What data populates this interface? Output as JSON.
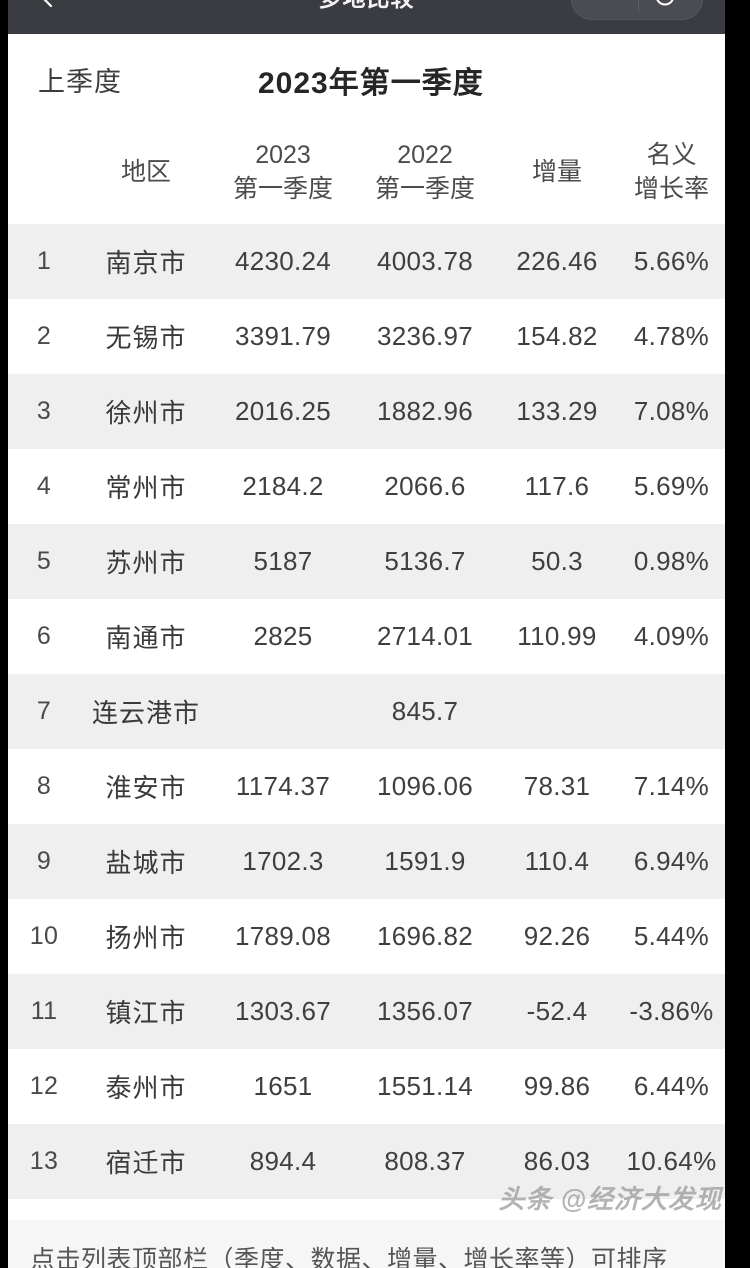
{
  "navbar": {
    "title": "多地比较",
    "back_icon": "back-chevron-icon",
    "menu_icon": "more-dots-icon",
    "target_icon": "target-circle-icon"
  },
  "quarter_bar": {
    "prev_label": "上季度",
    "current_label": "2023年第一季度"
  },
  "table": {
    "headers": [
      {
        "line1": "",
        "line2": ""
      },
      {
        "line1": "",
        "line2": "地区"
      },
      {
        "line1": "2023",
        "line2": "第一季度"
      },
      {
        "line1": "2022",
        "line2": "第一季度"
      },
      {
        "line1": "",
        "line2": "增量"
      },
      {
        "line1": "名义",
        "line2": "增长率"
      }
    ],
    "rows": [
      {
        "rank": "1",
        "name": "南京市",
        "y2023": "4230.24",
        "y2022": "4003.78",
        "increment": "226.46",
        "rate": "5.66%"
      },
      {
        "rank": "2",
        "name": "无锡市",
        "y2023": "3391.79",
        "y2022": "3236.97",
        "increment": "154.82",
        "rate": "4.78%"
      },
      {
        "rank": "3",
        "name": "徐州市",
        "y2023": "2016.25",
        "y2022": "1882.96",
        "increment": "133.29",
        "rate": "7.08%"
      },
      {
        "rank": "4",
        "name": "常州市",
        "y2023": "2184.2",
        "y2022": "2066.6",
        "increment": "117.6",
        "rate": "5.69%"
      },
      {
        "rank": "5",
        "name": "苏州市",
        "y2023": "5187",
        "y2022": "5136.7",
        "increment": "50.3",
        "rate": "0.98%"
      },
      {
        "rank": "6",
        "name": "南通市",
        "y2023": "2825",
        "y2022": "2714.01",
        "increment": "110.99",
        "rate": "4.09%"
      },
      {
        "rank": "7",
        "name": "连云港市",
        "y2023": "",
        "y2022": "845.7",
        "increment": "",
        "rate": ""
      },
      {
        "rank": "8",
        "name": "淮安市",
        "y2023": "1174.37",
        "y2022": "1096.06",
        "increment": "78.31",
        "rate": "7.14%"
      },
      {
        "rank": "9",
        "name": "盐城市",
        "y2023": "1702.3",
        "y2022": "1591.9",
        "increment": "110.4",
        "rate": "6.94%"
      },
      {
        "rank": "10",
        "name": "扬州市",
        "y2023": "1789.08",
        "y2022": "1696.82",
        "increment": "92.26",
        "rate": "5.44%"
      },
      {
        "rank": "11",
        "name": "镇江市",
        "y2023": "1303.67",
        "y2022": "1356.07",
        "increment": "-52.4",
        "rate": "-3.86%"
      },
      {
        "rank": "12",
        "name": "泰州市",
        "y2023": "1651",
        "y2022": "1551.14",
        "increment": "99.86",
        "rate": "6.44%"
      },
      {
        "rank": "13",
        "name": "宿迁市",
        "y2023": "894.4",
        "y2022": "808.37",
        "increment": "86.03",
        "rate": "10.64%"
      }
    ]
  },
  "footer": {
    "hint": "点击列表顶部栏（季度、数据、增量、增长率等）可排序"
  },
  "watermark": {
    "text": "头条 @经济大发现"
  },
  "colors": {
    "navbar_bg": "#3a3c41",
    "sheet_bg": "#ffffff",
    "row_odd": "#efefef",
    "row_even": "#ffffff",
    "text_primary": "#3f3f3f",
    "letterbox": "#000000"
  }
}
